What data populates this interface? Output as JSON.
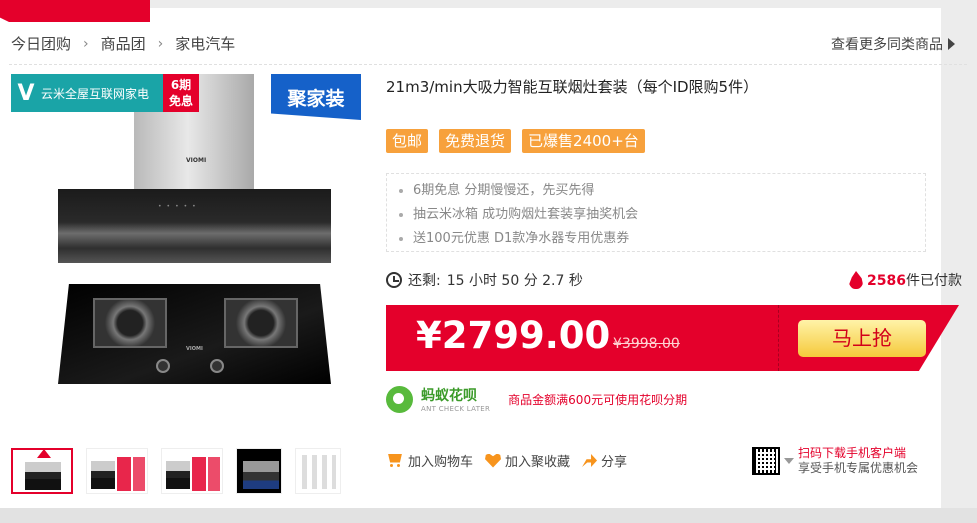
{
  "breadcrumb": [
    "今日团购",
    "商品团",
    "家电汽车"
  ],
  "more_link": "查看更多同类商品",
  "image": {
    "brand_letter": "V",
    "brand_text": "云米全屋互联网家电",
    "installment_badge_l1": "6期",
    "installment_badge_l2": "免息",
    "jujia_tag": "聚家装",
    "hood_logo": "VIOMI",
    "hob_logo": "VIOMI"
  },
  "product": {
    "title": "21m3/min大吸力智能互联烟灶套装（每个ID限购5件）",
    "tags": [
      "包邮",
      "免费退货",
      "已爆售2400+台"
    ],
    "promos": [
      "6期免息 分期慢慢还，先买先得",
      "抽云米冰箱 成功购烟灶套装享抽奖机会",
      "送100元优惠 D1款净水器专用优惠券"
    ]
  },
  "countdown": {
    "label": "还剩:",
    "value": "15 小时 50 分 2.7 秒"
  },
  "sold": {
    "count": "2586",
    "suffix": "件已付款"
  },
  "price": {
    "current": "¥2799.00",
    "original": "¥3998.00",
    "buy_label": "马上抢"
  },
  "huabei": {
    "name_cn": "蚂蚁花呗",
    "name_en": "ANT CHECK LATER",
    "note": "商品金额满600元可使用花呗分期"
  },
  "actions": {
    "add_cart": "加入购物车",
    "add_fav": "加入聚收藏",
    "share": "分享"
  },
  "qr": {
    "line1": "扫码下载手机客户端",
    "line2": "享受手机专属优惠机会"
  },
  "colors": {
    "accent_red": "#e4002b",
    "tag_orange": "#f7a13c",
    "brand_teal": "#1aa4a7",
    "jujia_blue": "#1561c9"
  }
}
